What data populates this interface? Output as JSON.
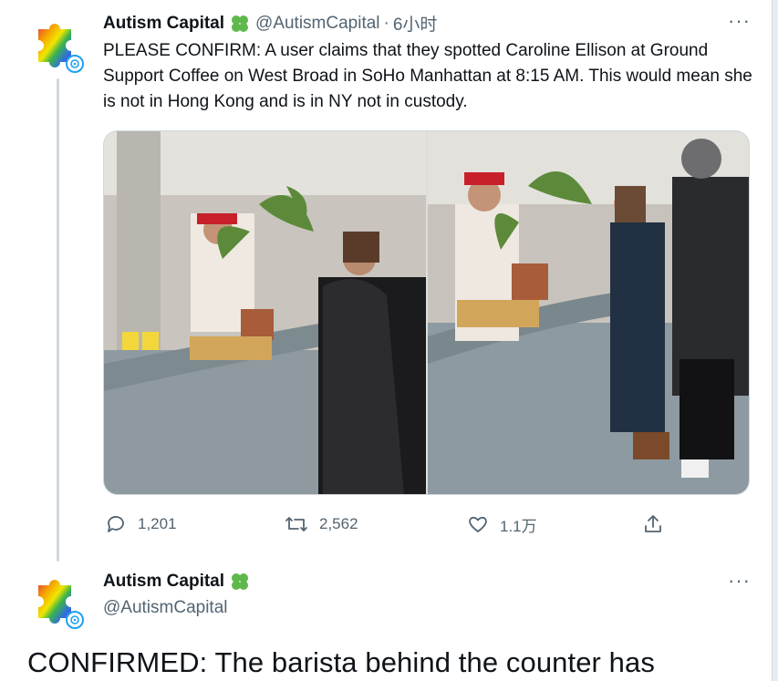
{
  "colors": {
    "text": "#0f1419",
    "muted": "#536471",
    "accent_green": "#5fb84c",
    "verified_ring": "#1da1f2"
  },
  "tweet1": {
    "author_name": "Autism Capital",
    "handle": "@AutismCapital",
    "separator": "·",
    "time": "6小时",
    "text": "PLEASE CONFIRM: A user claims that they spotted Caroline Ellison at Ground Support Coffee on West Broad in SoHo Manhattan at 8:15 AM. This would mean she is not in Hong Kong and is in NY not in custody.",
    "more_label": "···",
    "actions": {
      "replies": "1,201",
      "retweets": "2,562",
      "likes": "1.1万"
    }
  },
  "tweet2": {
    "author_name": "Autism Capital",
    "handle": "@AutismCapital",
    "more_label": "···",
    "text": "CONFIRMED: The barista behind the counter has"
  },
  "icons": {
    "avatar": "puzzle-piece-rainbow",
    "clover": "four-leaf-clover-icon",
    "reply": "reply-icon",
    "retweet": "retweet-icon",
    "like": "heart-icon",
    "share": "share-icon"
  }
}
